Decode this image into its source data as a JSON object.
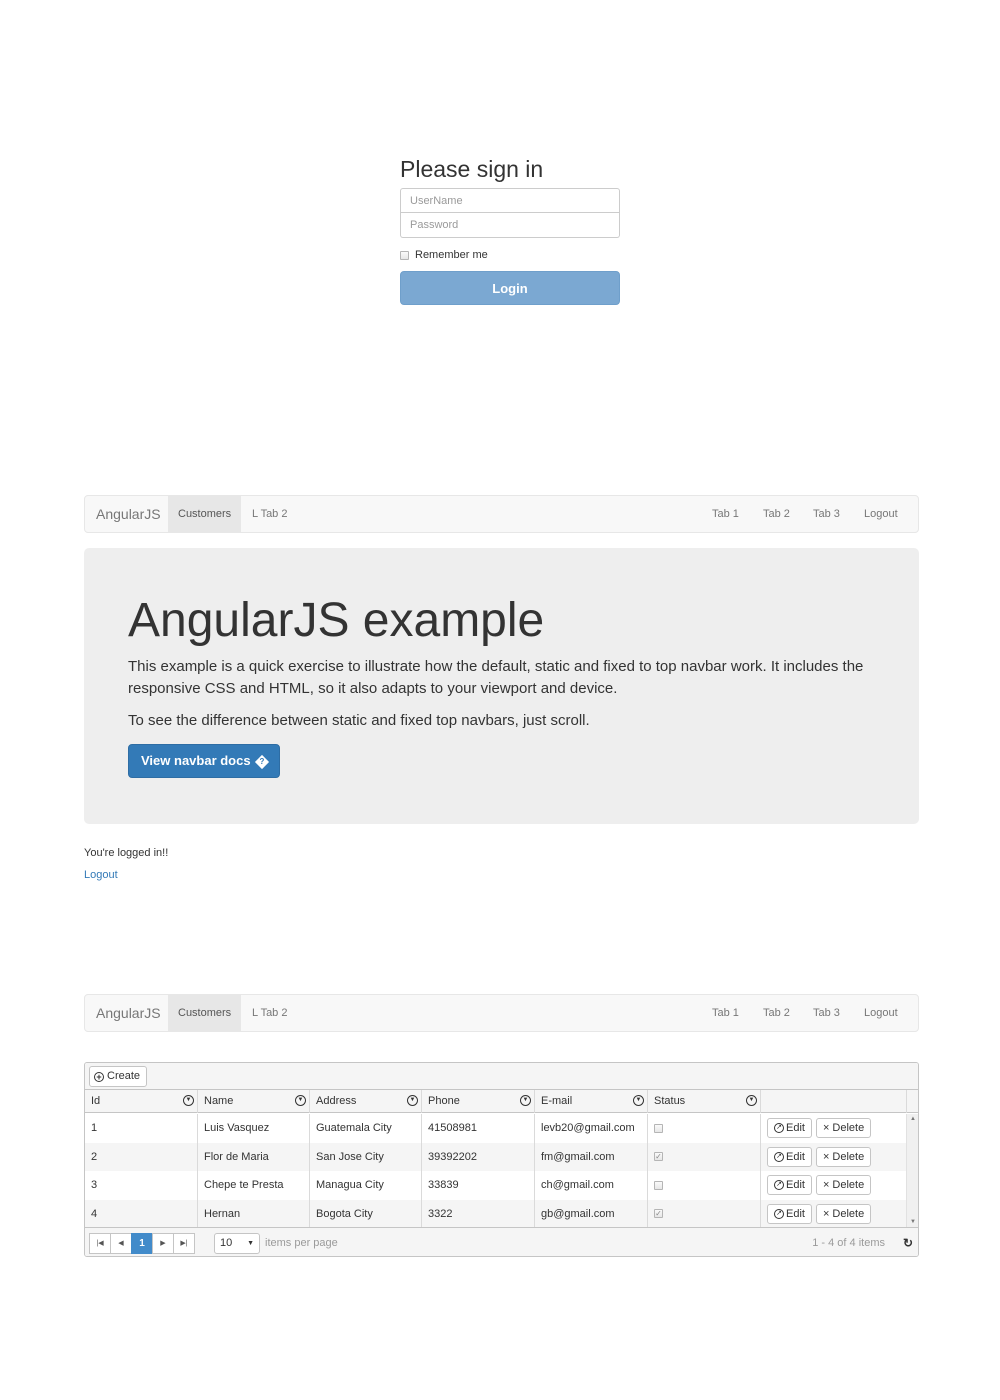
{
  "signin": {
    "title": "Please sign in",
    "username_placeholder": "UserName",
    "password_placeholder": "Password",
    "remember_label": "Remember me",
    "remember_checked": false,
    "login_label": "Login"
  },
  "navbar": {
    "brand": "AngularJS",
    "left_items": [
      "Customers",
      "L Tab 2"
    ],
    "active": "Customers",
    "right_items": [
      "Tab 1",
      "Tab 2",
      "Tab 3",
      "Logout"
    ]
  },
  "jumbotron": {
    "title": "AngularJS example",
    "paragraph1": "This example is a quick exercise to illustrate how the default, static and fixed to top navbar work. It includes the responsive CSS and HTML, so it also adapts to your viewport and device.",
    "paragraph2": "To see the difference between static and fixed top navbars, just scroll.",
    "button_label": "View navbar docs",
    "button_glyph": "?"
  },
  "status": {
    "logged_in_text": "You're logged in!!",
    "logout_link": "Logout"
  },
  "grid": {
    "create_label": "Create",
    "columns": [
      "Id",
      "Name",
      "Address",
      "Phone",
      "E-mail",
      "Status",
      ""
    ],
    "rows": [
      {
        "id": "1",
        "name": "Luis Vasquez",
        "address": "Guatemala City",
        "phone": "41508981",
        "email": "levb20@gmail.com",
        "status": false
      },
      {
        "id": "2",
        "name": "Flor de Maria",
        "address": "San Jose City",
        "phone": "39392202",
        "email": "fm@gmail.com",
        "status": true
      },
      {
        "id": "3",
        "name": "Chepe te Presta",
        "address": "Managua City",
        "phone": "33839",
        "email": "ch@gmail.com",
        "status": false
      },
      {
        "id": "4",
        "name": "Hernan",
        "address": "Bogota City",
        "phone": "3322",
        "email": "gb@gmail.com",
        "status": true
      }
    ],
    "edit_label": "Edit",
    "delete_label": "Delete",
    "pager": {
      "current_page": "1",
      "page_size": "10",
      "items_per_page_label": "items per page",
      "info": "1 - 4 of 4 items"
    }
  },
  "colors": {
    "primary": "#337ab7",
    "login_button": "#7ba8d2",
    "pager_active": "#428bca",
    "jumbotron_bg": "#eeeeee"
  }
}
